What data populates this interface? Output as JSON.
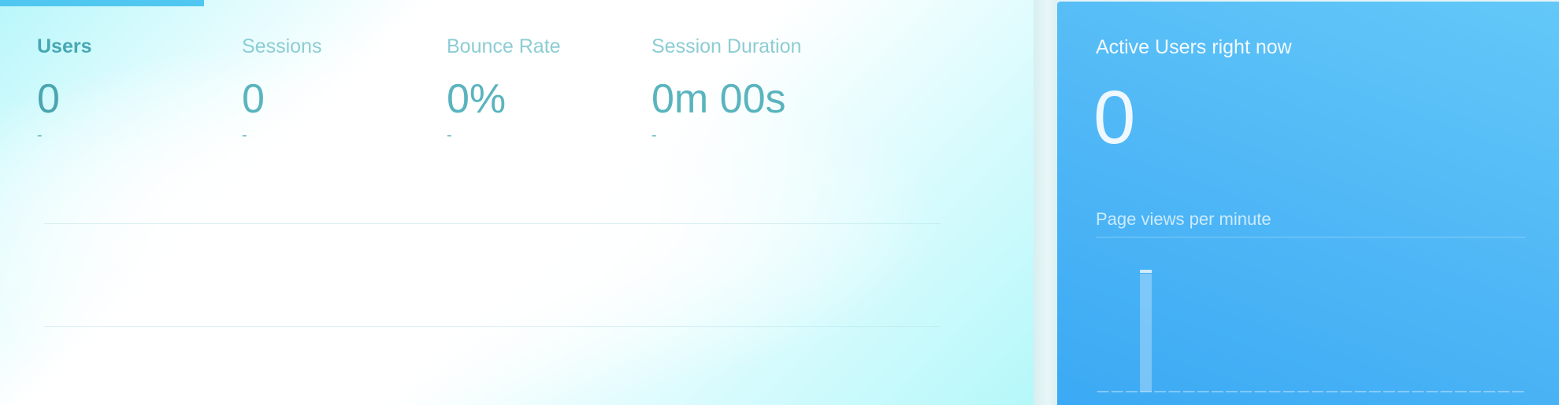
{
  "overview": {
    "metrics": [
      {
        "label": "Users",
        "value": "0",
        "delta": "-",
        "selected": true
      },
      {
        "label": "Sessions",
        "value": "0",
        "delta": "-",
        "selected": false
      },
      {
        "label": "Bounce Rate",
        "value": "0%",
        "delta": "-",
        "selected": false
      },
      {
        "label": "Session Duration",
        "value": "0m 00s",
        "delta": "-",
        "selected": false
      }
    ]
  },
  "realtime": {
    "title": "Active Users right now",
    "active_users": "0",
    "pageviews_label": "Page views per minute"
  },
  "colors": {
    "accent": "#50c7f0",
    "realtime_bg_top": "#63c8f8",
    "realtime_bg_bottom": "#3ba9f4",
    "metric_text": "#47a7b3"
  },
  "chart_data": {
    "type": "bar",
    "title": "",
    "xlabel": "",
    "ylabel": "",
    "ylim": [
      0,
      1
    ],
    "values": [
      0,
      0,
      0,
      1,
      0,
      0,
      0,
      0,
      0,
      0,
      0,
      0,
      0,
      0,
      0,
      0,
      0,
      0,
      0,
      0,
      0,
      0,
      0,
      0,
      0,
      0,
      0,
      0,
      0,
      0
    ],
    "grid": false
  }
}
